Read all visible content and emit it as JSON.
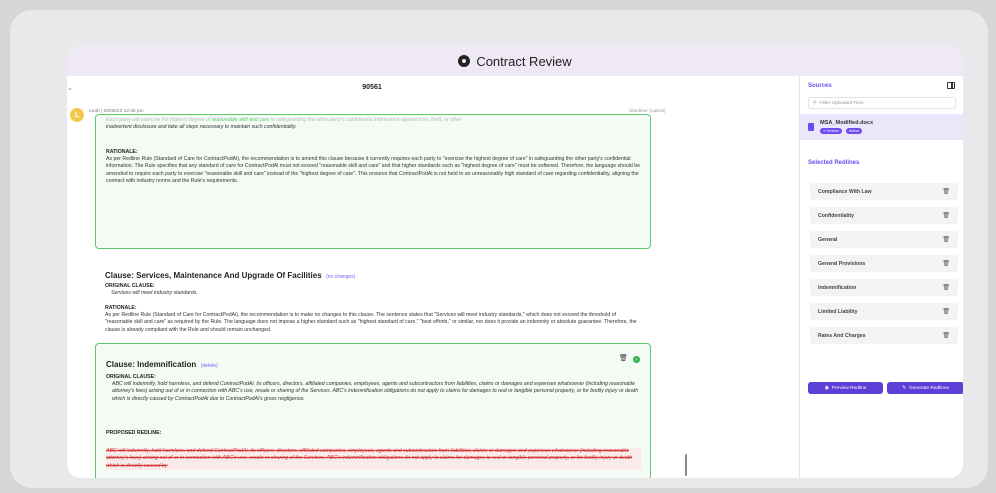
{
  "window": {
    "title": "Contract Review",
    "title_icon": "eye-icon"
  },
  "document": {
    "id": "90561",
    "avatar_initial": "L",
    "meta_left": "Leah | 05/05/23 12:46 pm",
    "meta_right": "Stanliner (Latest)",
    "card1": {
      "top_text_1": "Each party will exercise the highest degree of ",
      "top_text_mid": "reasonable skill and care",
      "top_text_2": " in safeguarding the other party's confidential information against loss, theft, or other",
      "top_text_3": "inadvertent disclosure and take all steps necessary to maintain such confidentiality.",
      "rationale_label": "RATIONALE:",
      "rationale": "As per Redline Rule (Standard of Care for ContractPodAi), the recommendation is to amend this clause because it currently requires each party to \"exercise the highest degree of care\" in safeguarding the other party's confidential information. The Rule specifies that any standard of care for ContractPodAi must not exceed \"reasonable skill and care\" and that higher standards such as \"highest degree of care\" must be softened. Therefore, the language should be amended to require each party to exercise \"reasonable skill and care\" instead of the \"highest degree of care\". This ensures that ContractPodAi is not held to an unreasonably high standard of care regarding confidentiality, aligning the contract with industry norms and the Rule's requirements."
    },
    "card2": {
      "title": "Clause: Services, Maintenance And Upgrade Of Facilities",
      "tag": "(no changes)",
      "original_label": "ORIGINAL CLAUSE:",
      "original": "Services will meet industry standards.",
      "rationale_label": "RATIONALE:",
      "rationale": "As per Redline Rule (Standard of Care for ContractPodAi), the recommendation is to make no changes to this clause. The sentence states that \"Services will meet industry standards,\" which does not exceed the threshold of \"reasonable skill and care\" as required by the Rule. The language does not impose a higher standard such as \"highest standard of care,\" \"best efforts,\" or similar, nor does it provide an indemnity or absolute guarantee. Therefore, the clause is already compliant with the Rule and should remain unchanged."
    },
    "card3": {
      "title": "Clause: Indemnification",
      "tag": "(delete)",
      "original_label": "ORIGINAL CLAUSE:",
      "original": "ABC will indemnify, hold harmless, and defend ContractPodAi, its officers, directors, affiliated companies, employees, agents and subcontractors from liabilities, claims or damages and expenses whatsoever (including reasonable attorney's fees) arising out of or in connection with ABC's use, resale or sharing of the Services. ABC's indemnification obligations do not apply to claims for damages to real or tangible personal property, or for bodily injury or death which is directly caused by ContractPodAi due to ContractPodAi's gross negligence.",
      "proposed_label": "PROPOSED REDLINE:",
      "proposed": "ABC will indemnify, hold harmless, and defend ContractPodAi, its officers, directors, affiliated companies, employees, agents and subcontractors from liabilities, claims or damages and expenses whatsoever (including reasonable attorney's fees) arising out of or in connection with ABC's use, resale or sharing of the Services. ABC's indemnification obligations do not apply to claims for damages to real or tangible personal property, or for bodily injury or death which is directly caused by"
    }
  },
  "sidebar": {
    "sources_title": "Sources",
    "filter_placeholder": "Filter Uploaded Files",
    "file_name": "MSA_Modified.docx",
    "file_version": "1 Version",
    "file_status": "Active",
    "selected_title": "Selected Redlines",
    "redlines": [
      "Compliance With Law",
      "Confidentiality",
      "General",
      "General Provisions",
      "Indemnification",
      "Limited Liability",
      "Rates And Charges"
    ],
    "preview_label": "Preview Redline",
    "generate_label": "Generate Redlines"
  },
  "colors": {
    "accent": "#6b4cf0",
    "success": "#5cc970",
    "delete": "#d23a3a"
  }
}
